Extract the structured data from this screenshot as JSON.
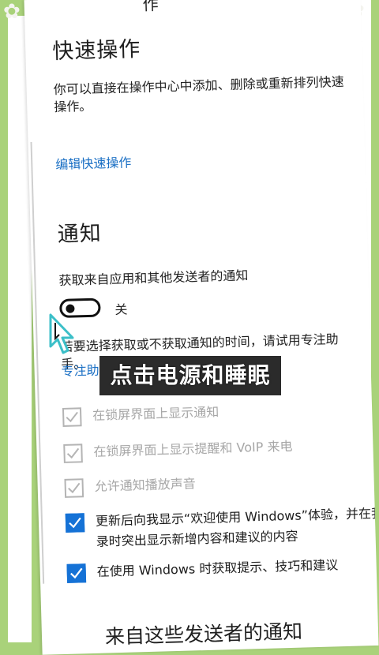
{
  "header": {
    "truncated_title": "作"
  },
  "quick_actions": {
    "title": "快速操作",
    "description": "你可以直接在操作中心中添加、删除或重新排列快速操作。",
    "edit_link": "编辑快速操作"
  },
  "notifications": {
    "title": "通知",
    "get_notifications_label": "获取来自应用和其他发送者的通知",
    "toggle_state": "关",
    "hint_text": "若要选择获取或不获取通知的时间，请试用专注助手。",
    "focus_link": "专注助手",
    "checkboxes": [
      {
        "label": "在锁屏界面上显示通知",
        "checked": false,
        "enabled": false
      },
      {
        "label": "在锁屏界面上显示提醒和 VoIP 来电",
        "checked": false,
        "enabled": false
      },
      {
        "label": "允许通知播放声音",
        "checked": false,
        "enabled": false
      },
      {
        "label": "更新后向我显示“欢迎使用 Windows”体验，并在我登录时突出显示新增内容和建议的内容",
        "label_line1": "更新后向我显示“欢迎使用 Windows”体验，并在我登",
        "label_line2": "录时突出显示新增内容和建议的内容",
        "checked": true,
        "enabled": true
      },
      {
        "label": "在使用 Windows 时获取提示、技巧和建议",
        "checked": true,
        "enabled": true
      }
    ],
    "senders_title": "来自这些发送者的通知"
  },
  "overlay": {
    "caption": "点击电源和睡眠"
  },
  "colors": {
    "link": "#1a6fc4",
    "checkbox_on": "#1572d6",
    "background": "#a9d27a"
  },
  "icons": {
    "checkmark": "checkmark-icon",
    "cursor": "hand-cursor-icon"
  }
}
